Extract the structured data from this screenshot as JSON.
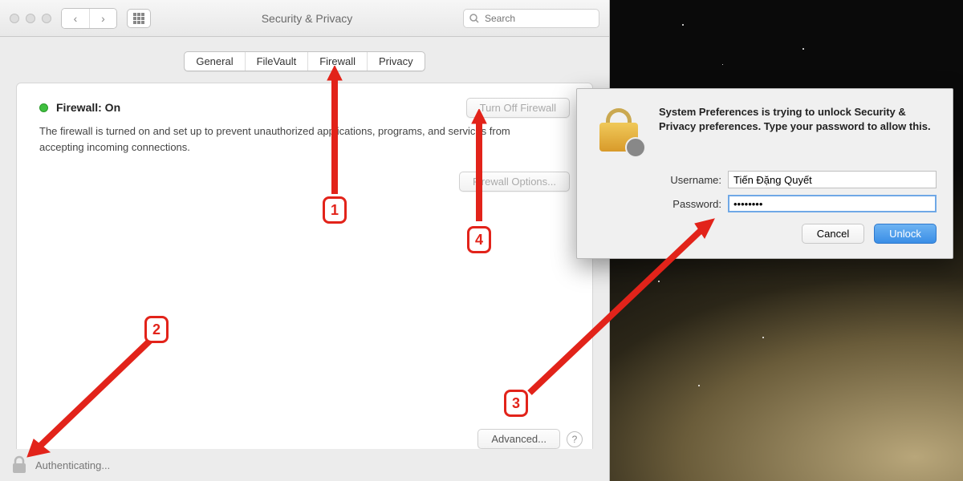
{
  "window": {
    "title": "Security & Privacy",
    "search_placeholder": "Search"
  },
  "tabs": {
    "general": "General",
    "filevault": "FileVault",
    "firewall": "Firewall",
    "privacy": "Privacy",
    "active": "Firewall"
  },
  "firewall": {
    "status_label": "Firewall: On",
    "description": "The firewall is turned on and set up to prevent unauthorized applications, programs, and services from accepting incoming connections.",
    "turn_off_label": "Turn Off Firewall",
    "options_label": "Firewall Options...",
    "advanced_label": "Advanced...",
    "help_label": "?"
  },
  "footer": {
    "auth_text": "Authenticating..."
  },
  "dialog": {
    "message": "System Preferences is trying to unlock Security & Privacy preferences. Type your password to allow this.",
    "username_label": "Username:",
    "password_label": "Password:",
    "username_value": "Tiến Đặng Quyết",
    "password_value": "••••••••",
    "cancel_label": "Cancel",
    "unlock_label": "Unlock"
  },
  "annotations": {
    "b1": "1",
    "b2": "2",
    "b3": "3",
    "b4": "4"
  }
}
